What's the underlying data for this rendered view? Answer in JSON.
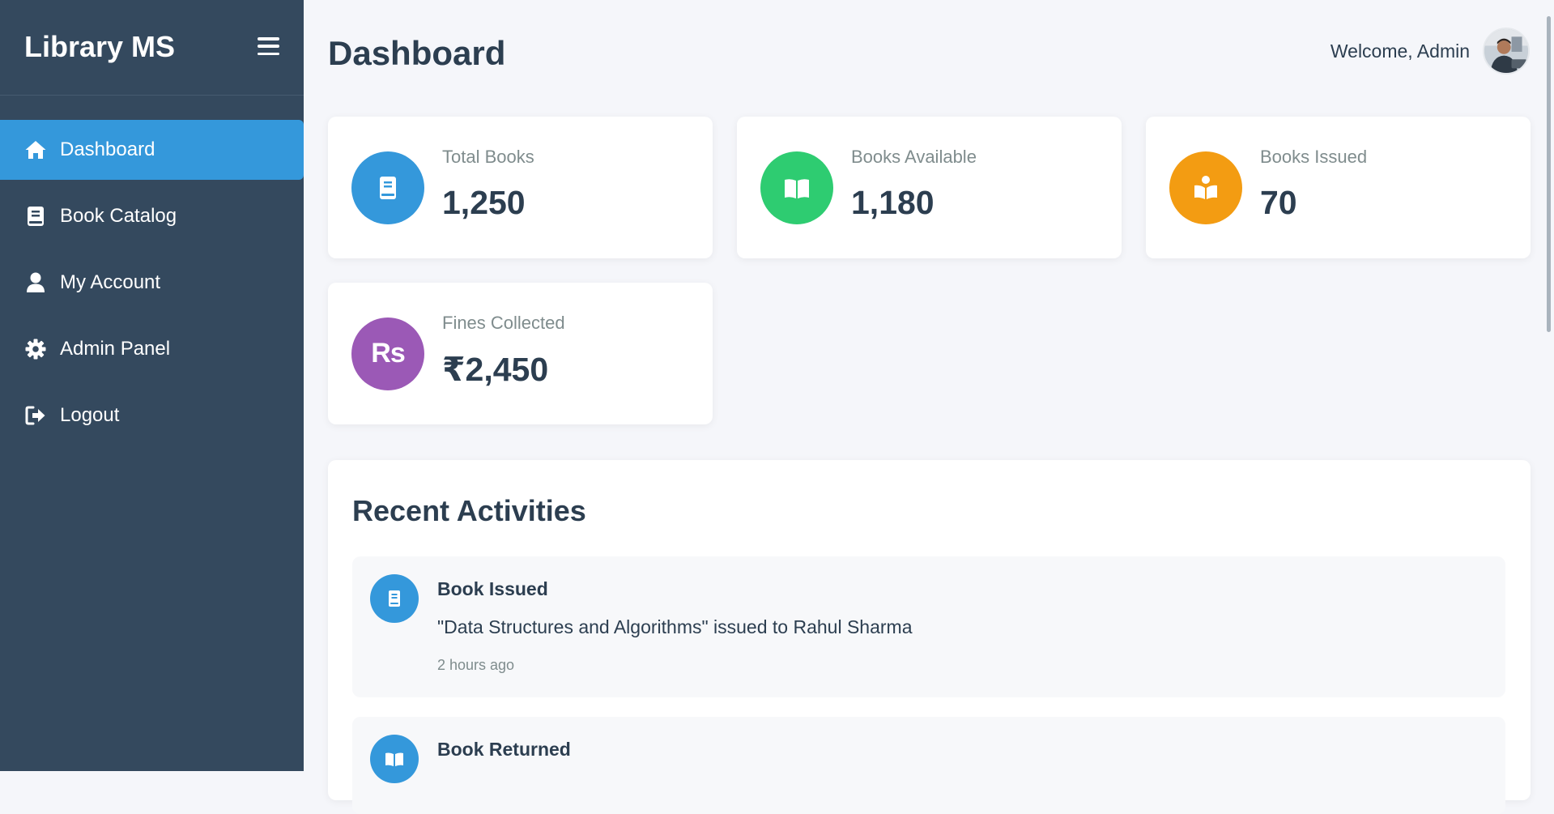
{
  "sidebar": {
    "brand": "Library MS",
    "items": [
      {
        "label": "Dashboard",
        "icon": "home-icon",
        "active": true
      },
      {
        "label": "Book Catalog",
        "icon": "book-icon",
        "active": false
      },
      {
        "label": "My Account",
        "icon": "user-icon",
        "active": false
      },
      {
        "label": "Admin Panel",
        "icon": "gear-icon",
        "active": false
      },
      {
        "label": "Logout",
        "icon": "logout-icon",
        "active": false
      }
    ]
  },
  "header": {
    "title": "Dashboard",
    "welcome": "Welcome, Admin",
    "avatar_icon": "avatar-photo"
  },
  "stats": [
    {
      "label": "Total Books",
      "value": "1,250",
      "icon": "book-icon",
      "color": "#3498db"
    },
    {
      "label": "Books Available",
      "value": "1,180",
      "icon": "open-book-icon",
      "color": "#2ecc71"
    },
    {
      "label": "Books Issued",
      "value": "70",
      "icon": "book-reader-icon",
      "color": "#f39c12"
    },
    {
      "label": "Fines Collected",
      "value": "₹2,450",
      "icon": "rupee-sign-icon",
      "icon_text": "Rs",
      "color": "#9b59b6"
    }
  ],
  "activities": {
    "title": "Recent Activities",
    "items": [
      {
        "title": "Book Issued",
        "description": "\"Data Structures and Algorithms\" issued to Rahul Sharma",
        "time": "2 hours ago",
        "icon": "book-icon"
      },
      {
        "title": "Book Returned",
        "description": "",
        "time": "",
        "icon": "open-book-icon"
      }
    ]
  },
  "colors": {
    "sidebar_bg": "#34495e",
    "active_nav": "#3498db",
    "page_bg": "#f5f6fa",
    "text_dark": "#2c3e50",
    "text_muted": "#7f8c8d"
  }
}
